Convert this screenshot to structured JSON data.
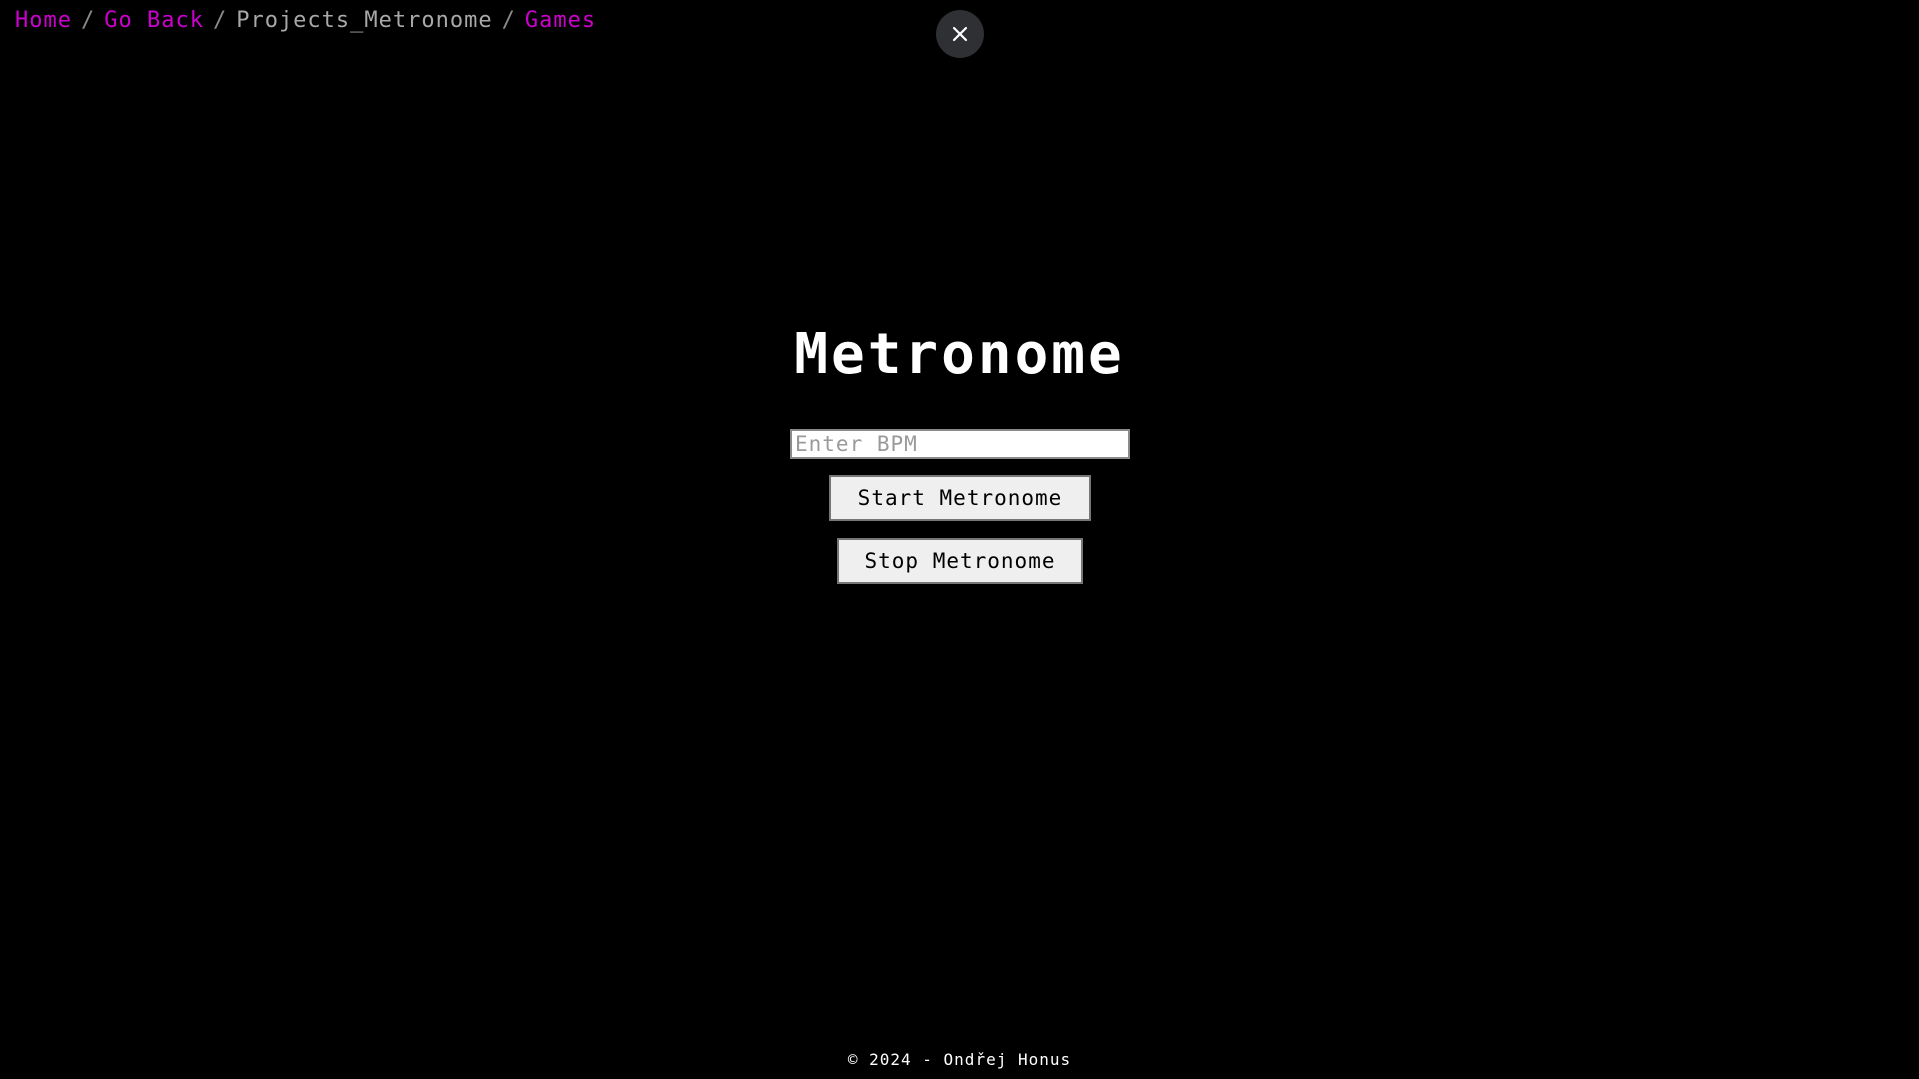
{
  "breadcrumb": {
    "items": [
      {
        "label": "Home"
      },
      {
        "label": "Go Back"
      },
      {
        "label": "Projects_Metronome"
      },
      {
        "label": "Games"
      }
    ],
    "separator": "/"
  },
  "close_button": {
    "icon": "close-icon"
  },
  "main": {
    "title": "Metronome",
    "bpm_input": {
      "value": "",
      "placeholder": "Enter BPM"
    },
    "start_label": "Start Metronome",
    "stop_label": "Stop Metronome"
  },
  "footer": {
    "text": "© 2024 - Ondřej Honus"
  },
  "colors": {
    "background": "#000000",
    "link": "#cc00cc",
    "current_crumb": "#a8a8a8",
    "text": "#ffffff",
    "close_bg": "#2f3033"
  }
}
